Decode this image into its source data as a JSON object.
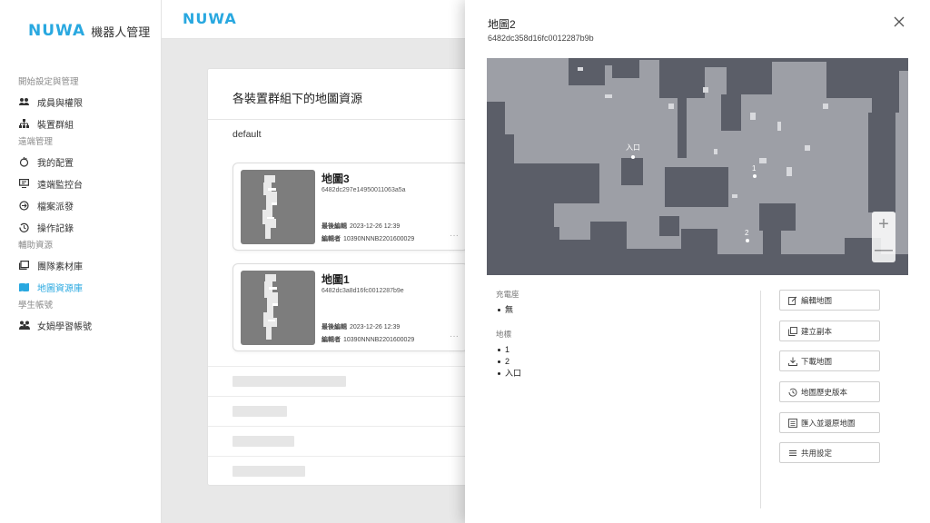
{
  "brand": {
    "logo_text": "NUWA",
    "product_name": "機器人管理"
  },
  "sidebar": {
    "sections": [
      {
        "title": "開始設定與管理",
        "items": [
          {
            "label": "成員與權限",
            "icon": "members-icon"
          },
          {
            "label": "裝置群組",
            "icon": "device-group-icon"
          }
        ]
      },
      {
        "title": "遠端管理",
        "items": [
          {
            "label": "我的配置",
            "icon": "config-icon"
          },
          {
            "label": "遠端監控台",
            "icon": "monitor-icon"
          },
          {
            "label": "檔案派發",
            "icon": "file-dispatch-icon"
          },
          {
            "label": "操作記錄",
            "icon": "history-icon"
          }
        ]
      },
      {
        "title": "輔助資源",
        "items": [
          {
            "label": "團隊素材庫",
            "icon": "library-icon"
          },
          {
            "label": "地圖資源庫",
            "icon": "map-icon",
            "active": true
          }
        ]
      },
      {
        "title": "學生帳號",
        "items": [
          {
            "label": "女媧學習帳號",
            "icon": "student-icon"
          }
        ]
      }
    ]
  },
  "main": {
    "title": "各裝置群組下的地圖資源",
    "group": "default",
    "maps": [
      {
        "name": "地圖3",
        "id": "6482dc297e14950011063a5a",
        "edited_label": "最後編輯",
        "edited": "2023-12-26 12:39",
        "editor_label": "編輯者",
        "editor": "10390NNNB2201600029",
        "more": "···"
      },
      {
        "name": "地圖1",
        "id": "6482dc3a8d16fc0012287b9e",
        "edited_label": "最後編輯",
        "edited": "2023-12-26 12:39",
        "editor_label": "編輯者",
        "editor": "10390NNNB2201600029",
        "more": "···"
      }
    ]
  },
  "drawer": {
    "title": "地圖2",
    "id": "6482dc358d16fc0012287b9b",
    "map_labels": {
      "entrance": "入口",
      "p1": "1",
      "p2": "2"
    },
    "zoom_in": "+",
    "zoom_out": "—",
    "charging_label": "充電座",
    "charging_items": [
      "無"
    ],
    "landmark_label": "地標",
    "landmark_items": [
      "1",
      "2",
      "入口"
    ],
    "actions": [
      {
        "label": "編輯地圖",
        "icon": "edit-icon"
      },
      {
        "label": "建立副本",
        "icon": "copy-icon"
      },
      {
        "label": "下載地圖",
        "icon": "download-icon"
      },
      {
        "label": "地圖歷史版本",
        "icon": "history-icon"
      },
      {
        "label": "匯入並還原地圖",
        "icon": "import-icon"
      },
      {
        "label": "共用設定",
        "icon": "share-settings-icon"
      }
    ]
  }
}
